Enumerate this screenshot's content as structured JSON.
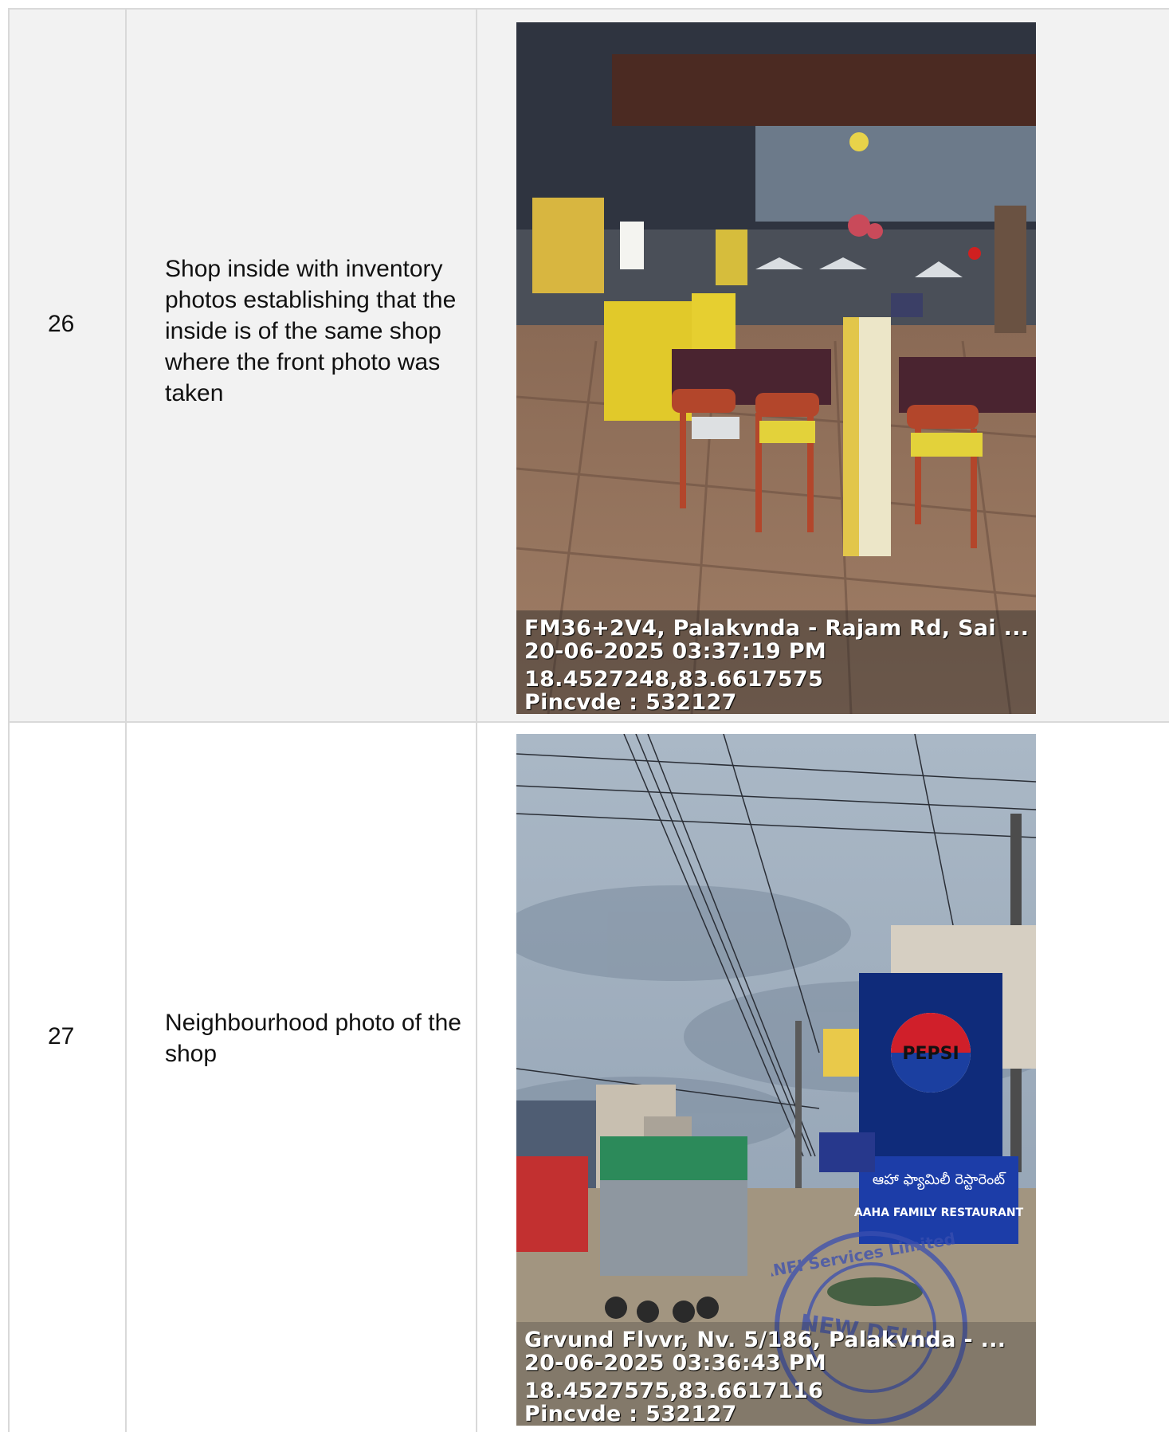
{
  "rows": [
    {
      "number": "26",
      "description": "Shop inside with inventory photos establishing that the inside is of the same shop where the front photo was taken",
      "photo": {
        "address": "FM36+2V4, Palakvnda - Rajam Rd, Sai ...",
        "datetime": "20-06-2025 03:37:19 PM",
        "coordinates": "18.4527248,83.6617575",
        "pincode": "Pincvde : 532127"
      }
    },
    {
      "number": "27",
      "description": "Neighbourhood photo of the shop",
      "photo": {
        "address": "Grvund Flvvr, Nv. 5/186, Palakvnda - ...",
        "datetime": "20-06-2025 03:36:43 PM",
        "coordinates": "18.4527575,83.6617116",
        "pincode": "Pincvde : 532127",
        "sign_brand": "PEPSI",
        "sign_telugu": "ఆహా ఫ్యామిలీ రెస్టారెంట్",
        "sign_name": "AAHA FAMILY RESTAURANT",
        "stamp_city": "NEW DELHI",
        "stamp_ring": "RNFI Services Limited"
      }
    }
  ],
  "colors": {
    "row_alt_bg": "#f2f2f2",
    "border": "#d9d9d9",
    "stamp": "#3a4fb0"
  }
}
